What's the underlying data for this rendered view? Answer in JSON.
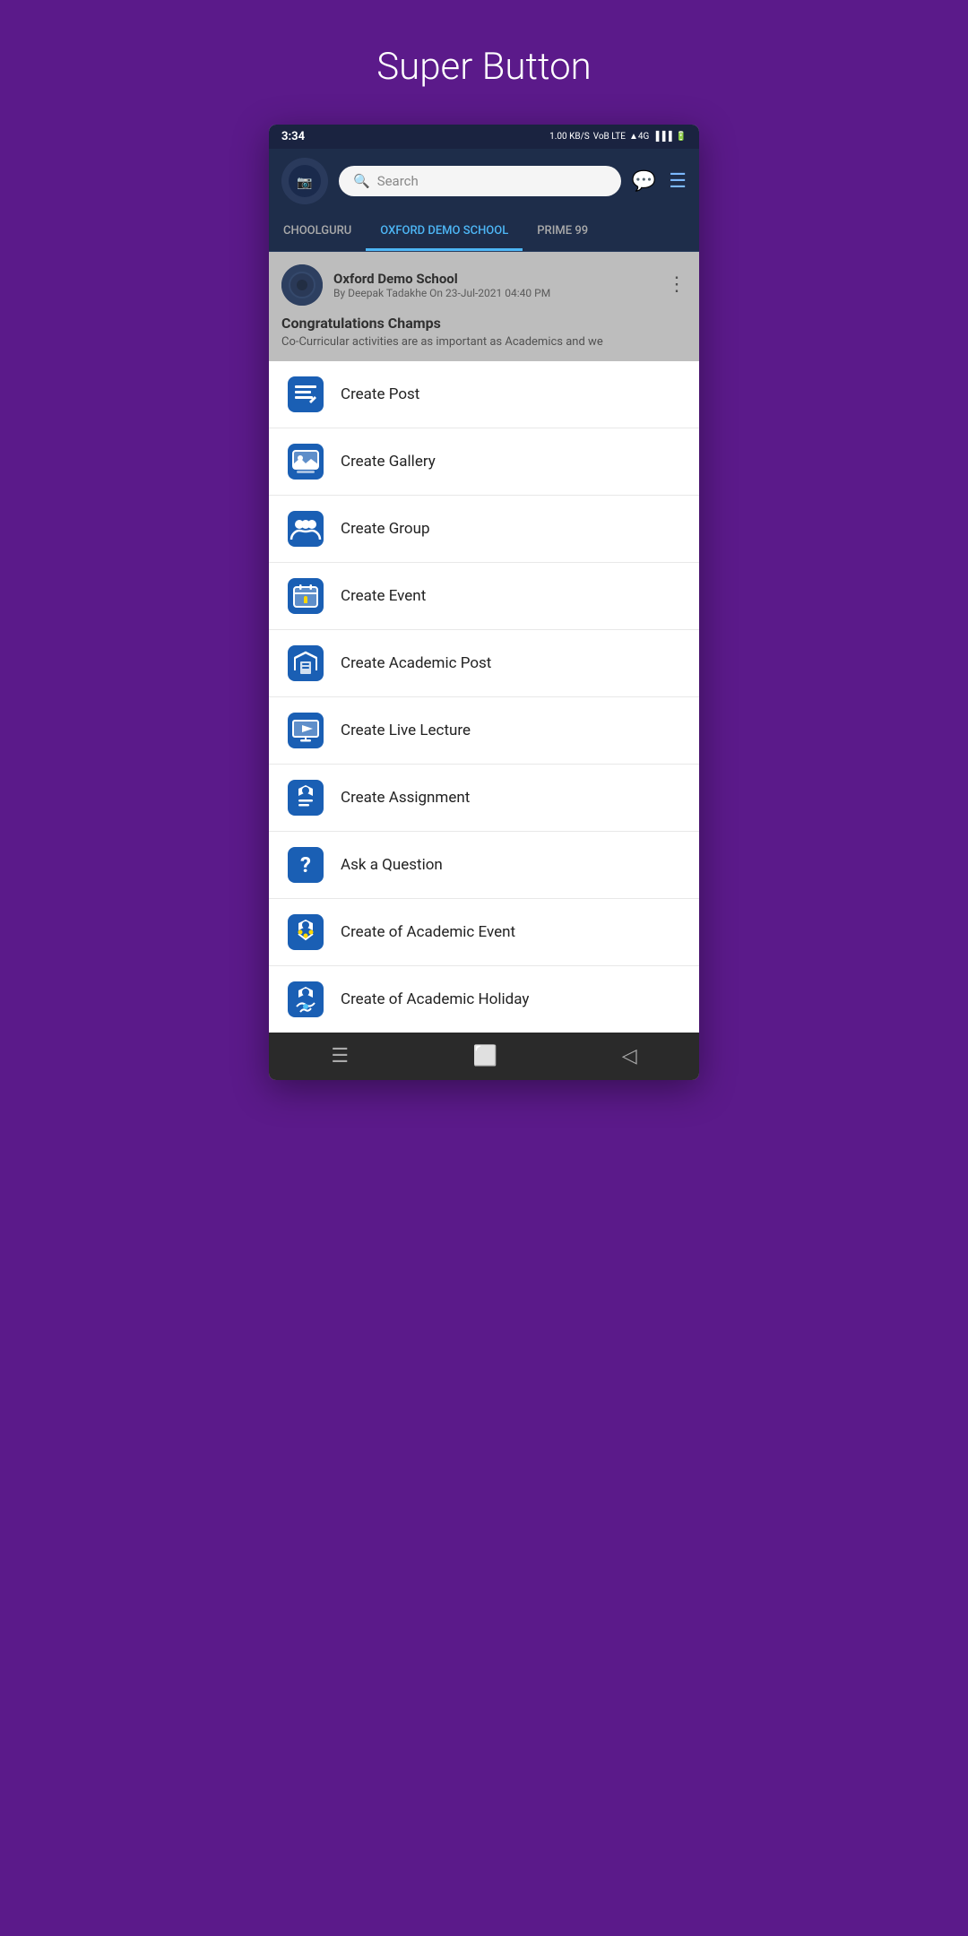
{
  "page": {
    "title": "Super Button"
  },
  "statusBar": {
    "time": "3:34",
    "network": "1.00 KB/S",
    "type": "VoB LTE",
    "signal": "4G"
  },
  "header": {
    "searchPlaceholder": "Search",
    "tabs": [
      {
        "label": "CHOOLGURU",
        "active": false
      },
      {
        "label": "OXFORD DEMO SCHOOL",
        "active": true
      },
      {
        "label": "PRIME 99",
        "active": false
      }
    ]
  },
  "postCard": {
    "schoolName": "Oxford Demo School",
    "meta": "By Deepak Tadakhe On 23-Jul-2021 04:40 PM",
    "title": "Congratulations Champs",
    "body": "Co-Curricular activities are as important as Academics and we"
  },
  "menuItems": [
    {
      "id": "create-post",
      "label": "Create Post",
      "icon": "post"
    },
    {
      "id": "create-gallery",
      "label": "Create Gallery",
      "icon": "gallery"
    },
    {
      "id": "create-group",
      "label": "Create Group",
      "icon": "group"
    },
    {
      "id": "create-event",
      "label": "Create Event",
      "icon": "event"
    },
    {
      "id": "create-academic-post",
      "label": "Create Academic Post",
      "icon": "academic-post"
    },
    {
      "id": "create-live-lecture",
      "label": "Create Live Lecture",
      "icon": "live-lecture"
    },
    {
      "id": "create-assignment",
      "label": "Create Assignment",
      "icon": "assignment"
    },
    {
      "id": "ask-question",
      "label": "Ask a Question",
      "icon": "question"
    },
    {
      "id": "create-academic-event",
      "label": "Create of Academic Event",
      "icon": "academic-event"
    },
    {
      "id": "create-academic-holiday",
      "label": "Create of Academic Holiday",
      "icon": "academic-holiday"
    }
  ]
}
